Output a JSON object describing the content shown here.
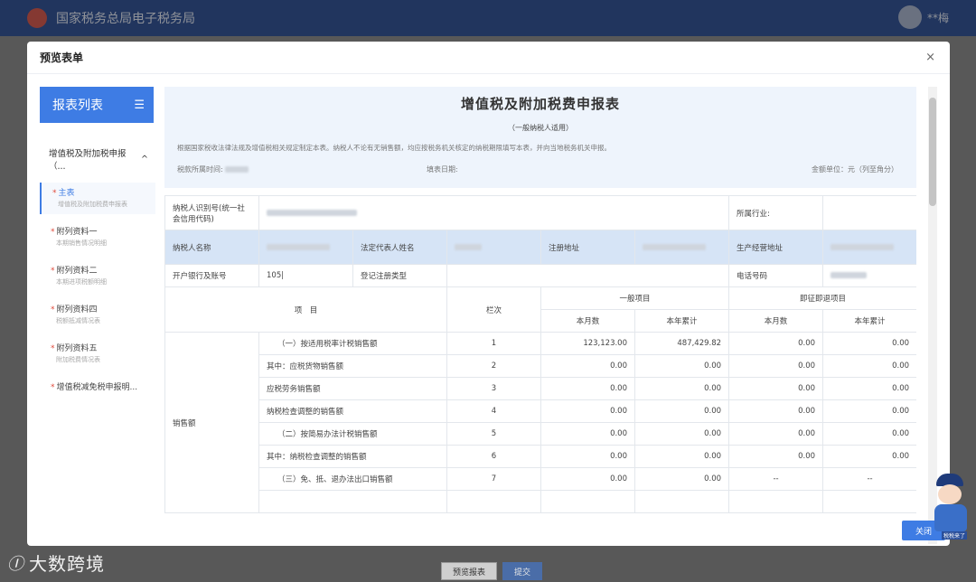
{
  "site": {
    "title": "国家税务总局电子税务局",
    "user": "**梅"
  },
  "modal": {
    "title": "预览表单",
    "close": "×"
  },
  "sidebar": {
    "title": "报表列表",
    "menu_icon": "☰",
    "group": "增值税及附加税申报（...",
    "group_icon": "^",
    "items": [
      {
        "name": "主表",
        "sub": "增值税及附加税费申报表"
      },
      {
        "name": "附列资料一",
        "sub": "本期销售情况明细"
      },
      {
        "name": "附列资料二",
        "sub": "本期进项税额明细"
      },
      {
        "name": "附列资料四",
        "sub": "税额抵减情况表"
      },
      {
        "name": "附列资料五",
        "sub": "附加税费情况表"
      },
      {
        "name": "增值税减免税申报明..."
      }
    ]
  },
  "form": {
    "title": "增值税及附加税费申报表",
    "subtitle": "（一般纳税人适用）",
    "note": "根据国家税收法律法规及增值税相关规定制定本表。纳税人不论有无销售额，均应按税务机关核定的纳税期限填写本表，并向当地税务机关申报。",
    "period_label": "税款所属时间:",
    "date_label": "填表日期:",
    "unit_label": "金额单位：元（列至角分）"
  },
  "info": {
    "taxid_label": "纳税人识别号(统一社会信用代码)",
    "industry_label": "所属行业:",
    "name_label": "纳税人名称",
    "legal_label": "法定代表人姓名",
    "reg_addr_label": "注册地址",
    "biz_addr_label": "生产经营地址",
    "bank_label": "开户银行及账号",
    "bank_value": "105|",
    "reg_type_label": "登记注册类型",
    "phone_label": "电话号码"
  },
  "table": {
    "item_header": "项　目",
    "col_header": "栏次",
    "general": "一般项目",
    "refund": "即征即退项目",
    "month": "本月数",
    "year": "本年累计",
    "category": "销售额",
    "rows": [
      {
        "item": "（一）按适用税率计税销售额",
        "no": "1",
        "g_m": "123,123.00",
        "g_y": "487,429.82",
        "r_m": "0.00",
        "r_y": "0.00"
      },
      {
        "item": "其中：应税货物销售额",
        "no": "2",
        "g_m": "0.00",
        "g_y": "0.00",
        "r_m": "0.00",
        "r_y": "0.00"
      },
      {
        "item": "应税劳务销售额",
        "no": "3",
        "g_m": "0.00",
        "g_y": "0.00",
        "r_m": "0.00",
        "r_y": "0.00"
      },
      {
        "item": "纳税检查调整的销售额",
        "no": "4",
        "g_m": "0.00",
        "g_y": "0.00",
        "r_m": "0.00",
        "r_y": "0.00"
      },
      {
        "item": "（二）按简易办法计税销售额",
        "no": "5",
        "g_m": "0.00",
        "g_y": "0.00",
        "r_m": "0.00",
        "r_y": "0.00"
      },
      {
        "item": "其中：纳税检查调整的销售额",
        "no": "6",
        "g_m": "0.00",
        "g_y": "0.00",
        "r_m": "0.00",
        "r_y": "0.00"
      },
      {
        "item": "（三）免、抵、退办法出口销售额",
        "no": "7",
        "g_m": "0.00",
        "g_y": "0.00",
        "r_m": "--",
        "r_y": "--"
      }
    ]
  },
  "buttons": {
    "close": "关闭",
    "preview": "预览报表",
    "submit": "提交"
  },
  "mascot_tag": "税税来了",
  "watermark": {
    "logo": "Ⓘ",
    "text": "大数跨境"
  }
}
